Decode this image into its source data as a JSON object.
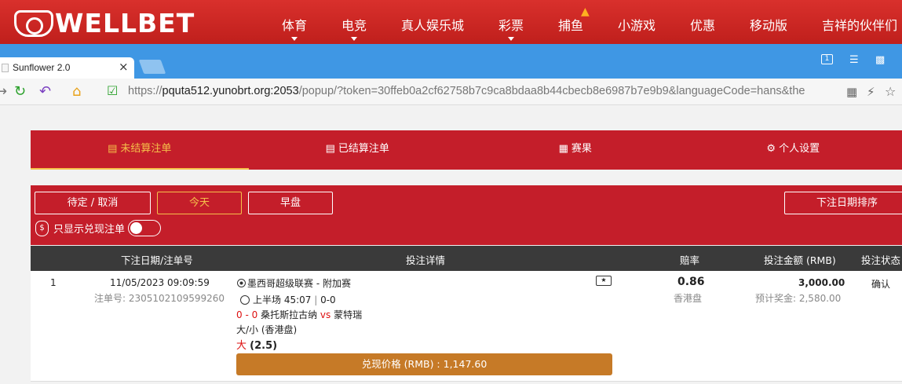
{
  "brand": {
    "name": "WELLBET"
  },
  "topnav": {
    "items": [
      "体育",
      "电竞",
      "真人娱乐城",
      "彩票",
      "捕鱼",
      "小游戏",
      "优惠",
      "移动版",
      "吉祥的伙伴们"
    ]
  },
  "browser": {
    "tab_title": "Sunflower 2.0",
    "tab_close": "×",
    "url_prefix": "https://",
    "url_host": "pquta512.yunobrt.org:2053",
    "url_path": "/popup/?token=30ffeb0a2cf62758b7c9ca8bdaa8b44cbecb8e6987b7e9b9&languageCode=hans&the",
    "window_box": "1"
  },
  "tabs": [
    {
      "label": "未结算注单",
      "icon": "unsettled-icon",
      "active": true
    },
    {
      "label": "已结算注单",
      "icon": "settled-icon",
      "active": false
    },
    {
      "label": "赛果",
      "icon": "results-icon",
      "active": false
    },
    {
      "label": "个人设置",
      "icon": "gear-icon",
      "active": false
    }
  ],
  "filters": {
    "pending": "待定 / 取消",
    "today": "今天",
    "early": "早盘",
    "sort": "下注日期排序",
    "cashout_only": "只显示兑现注单"
  },
  "table": {
    "headers": {
      "date": "下注日期/注单号",
      "details": "投注详情",
      "odds": "赔率",
      "amount": "投注金额 (RMB)",
      "status": "投注状态"
    },
    "row": {
      "index": "1",
      "date": "11/05/2023 09:09:59",
      "bet_no": "注单号: 2305102109599260",
      "league": "墨西哥超级联赛 - 附加赛",
      "period": "上半场 45:07",
      "period_score": "0-0",
      "score": "0 - 0",
      "home": "桑托斯拉古纳",
      "vs": "vs",
      "away": "蒙特瑞",
      "market": "大/小 (香港盘)",
      "selection": "大",
      "line": "(2.5)",
      "odds": "0.86",
      "odds_type": "香港盘",
      "amount": "3,000.00",
      "payout": "预计奖金: 2,580.00",
      "status": "确认",
      "cashout": "兑现价格 (RMB) : 1,147.60"
    }
  },
  "colors": {
    "brand_red": "#c41e2a",
    "accent_gold": "#f5c04a",
    "cashout_btn": "#c67a27",
    "browser_blue": "#3f97e4"
  }
}
